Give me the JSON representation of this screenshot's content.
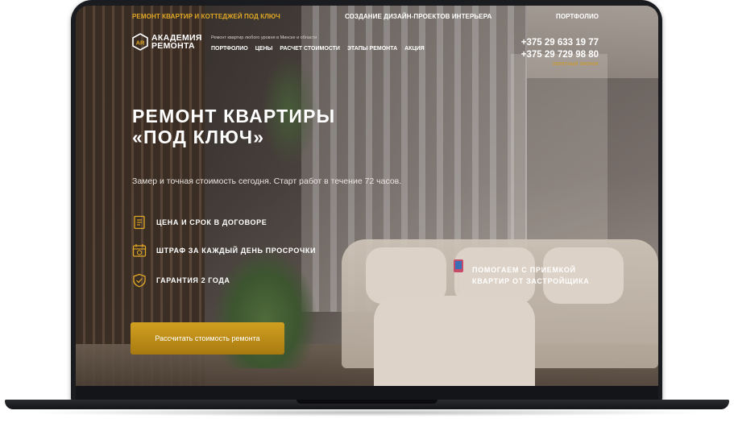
{
  "topbar": {
    "left": "РЕМОНТ КВАРТИР И КОТТЕДЖЕЙ ПОД КЛЮЧ",
    "center": "СОЗДАНИЕ ДИЗАЙН-ПРОЕКТОВ ИНТЕРЬЕРА",
    "right": "ПОРТФОЛИО"
  },
  "logo": {
    "mark": "AR",
    "line1": "АКАДЕМИЯ",
    "line2": "РЕМОНТА"
  },
  "tagline": "Ремонт квартир любого уровня в Минске и области",
  "nav": [
    "ПОРТФОЛИО",
    "ЦЕНЫ",
    "РАСЧЕТ СТОИМОСТИ",
    "ЭТАПЫ РЕМОНТА",
    "АКЦИЯ"
  ],
  "phones": [
    "+375 29 633 19 77",
    "+375 29 729 98 80"
  ],
  "callback": "ОБРАТНЫЙ ЗВОНОК",
  "hero": {
    "title_line1": "РЕМОНТ КВАРТИРЫ",
    "title_line2": "«ПОД КЛЮЧ»",
    "subtitle": "Замер и точная стоимость сегодня. Старт работ в течение 72 часов."
  },
  "features": [
    {
      "icon": "document-icon",
      "label": "ЦЕНА И СРОК В ДОГОВОРЕ"
    },
    {
      "icon": "calendar-icon",
      "label": "ШТРАФ ЗА КАЖДЫЙ ДЕНЬ ПРОСРОЧКИ"
    },
    {
      "icon": "shield-icon",
      "label": "ГАРАНТИЯ 2 ГОДА"
    }
  ],
  "cta_label": "Рассчитать стоимость ремонта",
  "promo": {
    "line1": "ПОМОГАЕМ С ПРИЕМКОЙ",
    "line2": "КВАРТИР ОТ ЗАСТРОЙЩИКА"
  },
  "colors": {
    "accent": "#e0a824",
    "button": "#c0901a"
  }
}
